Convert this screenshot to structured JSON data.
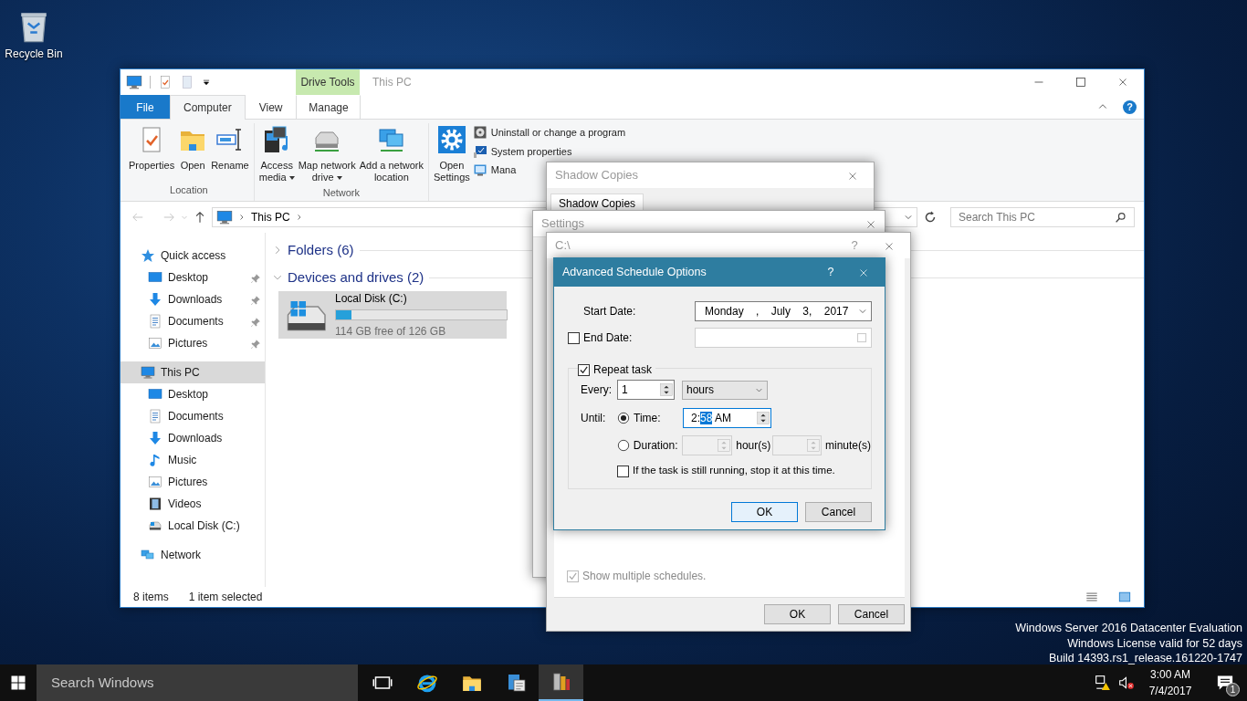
{
  "desktop": {
    "icons": [
      {
        "label": "Recycle Bin",
        "kind": "recycle-bin"
      }
    ],
    "watermark_lines": [
      "Windows Server 2016 Datacenter Evaluation",
      "Windows License valid for 52 days",
      "Build 14393.rs1_release.161220-1747"
    ]
  },
  "explorer": {
    "title": "This PC",
    "context_group": "Drive Tools",
    "help": "?",
    "tabs": [
      {
        "label": "File",
        "kind": "file",
        "selected": false
      },
      {
        "label": "Computer",
        "kind": "tab",
        "selected": true
      },
      {
        "label": "View",
        "kind": "tab",
        "selected": false
      },
      {
        "label": "Manage",
        "kind": "context",
        "selected": false
      }
    ],
    "ribbon_groups": [
      {
        "label": "Location",
        "items": [
          {
            "kind": "large",
            "lines": [
              "Properties"
            ],
            "dropdown": false
          },
          {
            "kind": "large",
            "lines": [
              "Open"
            ],
            "dropdown": false
          },
          {
            "kind": "large",
            "lines": [
              "Rename"
            ],
            "dropdown": false
          }
        ]
      },
      {
        "label": "Network",
        "items": [
          {
            "kind": "large",
            "lines": [
              "Access",
              "media"
            ],
            "dropdown": true
          },
          {
            "kind": "large",
            "lines": [
              "Map network",
              "drive"
            ],
            "dropdown": true
          },
          {
            "kind": "large",
            "lines": [
              "Add a network",
              "location"
            ],
            "dropdown": false
          }
        ]
      },
      {
        "items": [
          {
            "kind": "large",
            "lines": [
              "Open",
              "Settings"
            ],
            "dropdown": false
          },
          {
            "kind": "list",
            "entries": [
              {
                "label": "Uninstall or change a program"
              },
              {
                "label": "System properties"
              },
              {
                "label": "Mana"
              }
            ]
          }
        ]
      }
    ],
    "address": {
      "path": [
        "This PC"
      ]
    },
    "search": {
      "placeholder": "Search This PC"
    },
    "nav": [
      {
        "label": "Quick access",
        "selected": false,
        "children": [
          {
            "label": "Desktop",
            "pinned": true,
            "selected": false
          },
          {
            "label": "Downloads",
            "pinned": true,
            "selected": false
          },
          {
            "label": "Documents",
            "pinned": true,
            "selected": false
          },
          {
            "label": "Pictures",
            "pinned": true,
            "selected": false
          }
        ]
      },
      {
        "label": "This PC",
        "selected": true,
        "children": [
          {
            "label": "Desktop",
            "selected": false
          },
          {
            "label": "Documents",
            "selected": false
          },
          {
            "label": "Downloads",
            "selected": false
          },
          {
            "label": "Music",
            "selected": false
          },
          {
            "label": "Pictures",
            "selected": false
          },
          {
            "label": "Videos",
            "selected": false
          },
          {
            "label": "Local Disk (C:)",
            "selected": false
          }
        ]
      },
      {
        "label": "Network",
        "selected": false
      }
    ],
    "groups": [
      {
        "label": "Folders (6)",
        "expanded": false
      },
      {
        "label": "Devices and drives (2)",
        "expanded": true,
        "drives": [
          {
            "name": "Local Disk (C:)",
            "level": 0.09,
            "free": "114 GB free of 126 GB",
            "selected": true
          }
        ]
      }
    ],
    "status": [
      "8 items",
      "1 item selected"
    ]
  },
  "shadow_copies": {
    "title": "Shadow Copies",
    "tabs": [
      {
        "label": "Shadow Copies",
        "selected": true
      }
    ]
  },
  "settings": {
    "title": "Settings"
  },
  "schedule": {
    "title": "C:\\",
    "help": "?",
    "show_multiple": {
      "label": "Show multiple schedules.",
      "checked": true,
      "disabled": true
    },
    "buttons": [
      "OK",
      "Cancel"
    ]
  },
  "advanced": {
    "title": "Advanced Schedule Options",
    "help": "?",
    "start_date": {
      "label": "Start Date:",
      "value": "Monday , July 3, 2017"
    },
    "end_date": {
      "label": "End Date:",
      "checked": false
    },
    "repeat": {
      "label": "Repeat task",
      "checked": true
    },
    "every": {
      "label": "Every:",
      "value": "1",
      "unit": "hours"
    },
    "until": {
      "label": "Until:",
      "options": [
        {
          "kind": "time",
          "label": "Time:",
          "selected": true,
          "parts": [
            {
              "text": "2:",
              "selected": false
            },
            {
              "text": "58",
              "selected": true
            },
            {
              "text": " AM",
              "selected": false
            }
          ]
        },
        {
          "kind": "duration",
          "label": "Duration:",
          "selected": false,
          "hours_label": "hour(s)",
          "minutes_label": "minute(s)"
        }
      ]
    },
    "stop": {
      "label": "If the task is still running, stop it at this time.",
      "checked": false
    },
    "buttons": [
      {
        "label": "OK",
        "default": true
      },
      {
        "label": "Cancel",
        "default": false
      }
    ]
  },
  "taskbar": {
    "search_placeholder": "Search Windows",
    "apps": [
      {
        "active": false
      },
      {
        "active": false
      },
      {
        "active": false
      },
      {
        "active": false
      },
      {
        "active": true
      }
    ],
    "time": "3:00 AM",
    "date": "7/4/2017",
    "notifications": "1"
  }
}
